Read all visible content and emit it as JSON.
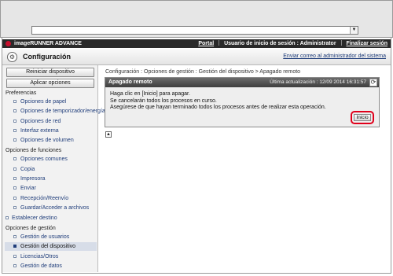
{
  "header": {
    "brand": "imageRUNNER ADVANCE",
    "portal_link": "Portal",
    "user_text": "Usuario de inicio de sesión : Administrator",
    "logout_link": "Finalizar sesión"
  },
  "titlebar": {
    "title": "Configuración",
    "email_link": "Enviar correo al administrador del sistema"
  },
  "sidebar": {
    "restart_button": "Reiniciar dispositivo",
    "apply_button": "Aplicar opciones",
    "sections": [
      {
        "label": "Preferencias",
        "items": [
          "Opciones de papel",
          "Opciones de temporizador/energía",
          "Opciones de red",
          "Interfaz externa",
          "Opciones de volumen"
        ]
      },
      {
        "label": "Opciones de funciones",
        "items": [
          "Opciones comunes",
          "Copia",
          "Impresora",
          "Enviar",
          "Recepción/Reenvío",
          "Guardar/Acceder a archivos"
        ]
      },
      {
        "label": "Establecer destino",
        "items": []
      },
      {
        "label": "Opciones de gestión",
        "items": [
          "Gestión de usuarios",
          "Gestión del dispositivo",
          "Licencias/Otros",
          "Gestión de datos"
        ]
      }
    ]
  },
  "main": {
    "breadcrumb": "Configuración : Opciones de gestión : Gestión del dispositivo > Apagado remoto",
    "panel": {
      "title": "Apagado remoto",
      "last_update": "Última actualización : 12/09 2014 16:31:57",
      "lines": [
        "Haga clic en [Inicio] para apagar.",
        "Se cancelarán todos los procesos en curso.",
        "Asegúrese de que hayan terminado todos los procesos antes de realizar esta operación."
      ],
      "start_button": "Inicio"
    }
  },
  "colors": {
    "brand_bar": "#2a2a2a",
    "link": "#1f3d7a",
    "highlight": "#e0001b",
    "active_item": "#d7dde8"
  }
}
